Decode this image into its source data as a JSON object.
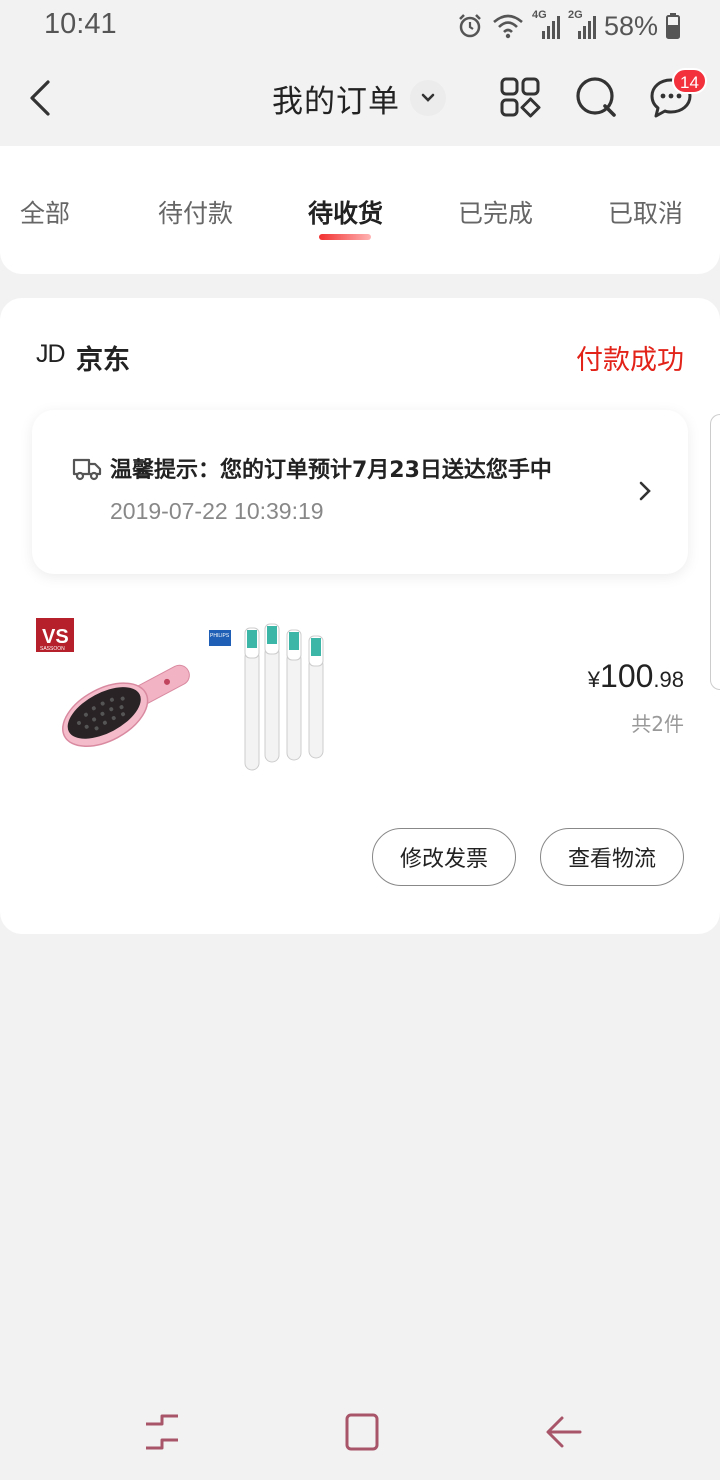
{
  "status_bar": {
    "time": "10:41",
    "network_4g": "4G",
    "network_2g": "2G",
    "battery": "58%"
  },
  "header": {
    "title": "我的订单",
    "message_badge": "14",
    "icons": [
      "back-arrow-icon",
      "chevron-down-icon",
      "grid-menu-icon",
      "search-icon",
      "message-icon"
    ]
  },
  "tabs": [
    {
      "label": "全部",
      "active": false
    },
    {
      "label": "待付款",
      "active": false
    },
    {
      "label": "待收货",
      "active": true
    },
    {
      "label": "已完成",
      "active": false
    },
    {
      "label": "已取消",
      "active": false
    }
  ],
  "order": {
    "shop_logo": "JD",
    "shop_name": "京东",
    "status": "付款成功",
    "notice": {
      "text": "温馨提示：您的订单预计7月23日送达您手中",
      "time": "2019-07-22 10:39:19"
    },
    "product_icons": [
      "hair-brush-product-image",
      "toothbrush-heads-product-image"
    ],
    "product_badges": {
      "brand_vs": "VS",
      "brand_vs_sub": "SASSOON",
      "brand_philips": "PHILIPS"
    },
    "price": {
      "currency": "¥",
      "integer": "100",
      "decimal": ".98"
    },
    "item_count": "共2件",
    "buttons": {
      "modify_invoice": "修改发票",
      "view_logistics": "查看物流"
    }
  },
  "colors": {
    "accent_red": "#e2231a",
    "badge_red": "#f2313d",
    "background": "#f2f2f2",
    "nav_icon": "#a8556a"
  }
}
